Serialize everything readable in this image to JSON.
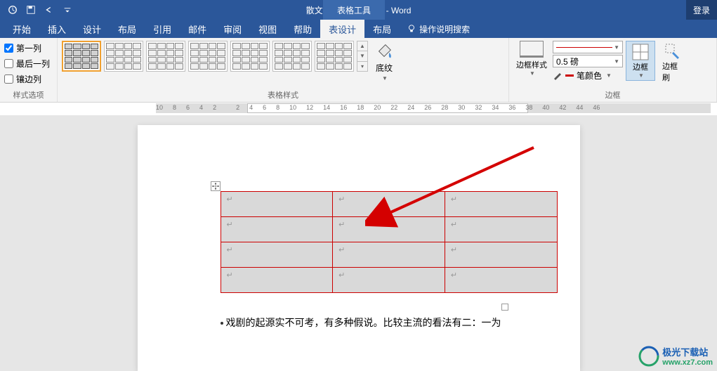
{
  "titlebar": {
    "doc_title": "散文.docx [兼容模式] - Word",
    "table_tools": "表格工具",
    "login": "登录"
  },
  "tabs": {
    "items": [
      "开始",
      "插入",
      "设计",
      "布局",
      "引用",
      "邮件",
      "审阅",
      "视图",
      "帮助",
      "表设计",
      "布局"
    ],
    "tellme": "操作说明搜索"
  },
  "style_options": {
    "first_col": "第一列",
    "last_col": "最后一列",
    "banded_col": "镶边列",
    "group_label": "样式选项",
    "first_col_checked": true,
    "last_col_checked": false,
    "banded_col_checked": false
  },
  "table_styles": {
    "group_label": "表格样式",
    "shading": "底纹"
  },
  "borders": {
    "group_label": "边框",
    "border_style": "边框样式",
    "weight": "0.5 磅",
    "pen_color": "笔颜色",
    "borders_btn": "边框",
    "painter": "边框刷"
  },
  "ruler": {
    "ticks": [
      "10",
      "8",
      "6",
      "4",
      "2",
      "",
      "2",
      "4",
      "6",
      "8",
      "10",
      "12",
      "14",
      "16",
      "18",
      "20",
      "22",
      "24",
      "26",
      "28",
      "30",
      "32",
      "34",
      "36",
      "38",
      "40",
      "42",
      "44",
      "46"
    ]
  },
  "document": {
    "cell_mark": "↵",
    "body_line1": "戏剧的起源实不可考，有多种假说。比较主流的看法有二：一为"
  },
  "chart_data": {
    "type": "table",
    "rows": 4,
    "cols": 3,
    "cells": [
      [
        "",
        "",
        ""
      ],
      [
        "",
        "",
        ""
      ],
      [
        "",
        "",
        ""
      ],
      [
        "",
        "",
        ""
      ]
    ],
    "border_color": "#cc0000",
    "fill_color": "#d9d9d9"
  },
  "watermark": {
    "name": "极光下载站",
    "url": "www.xz7.com"
  }
}
